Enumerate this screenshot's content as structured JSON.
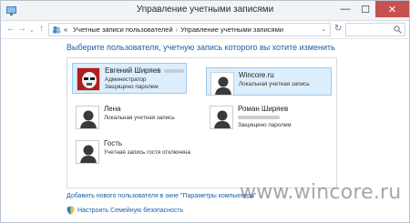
{
  "window": {
    "title": "Управление учетными записями",
    "minimize_glyph": "—",
    "maximize_glyph": "☐",
    "close_glyph": "✕"
  },
  "nav": {
    "back_glyph": "←",
    "forward_glyph": "→",
    "recent_glyph": "⌄",
    "up_glyph": "↑",
    "refresh_glyph": "↻",
    "breadcrumb_prefix": "«",
    "breadcrumb": [
      "Учетные записи пользователей",
      "Управление учетными записями"
    ],
    "separator": "›",
    "dropdown_glyph": "⌄",
    "search_placeholder": ""
  },
  "main": {
    "heading": "Выберите пользователя, учетную запись которого вы хотите изменить",
    "users": [
      {
        "name": "Евгений Ширяев",
        "line1": "Администратор",
        "line2": "Защищено паролем",
        "avatar": "stormtrooper-avatar",
        "selected": true
      },
      {
        "name": "Wincore.ru",
        "line1": "Локальная учетная запись",
        "line2": "",
        "avatar": "default-user-avatar",
        "selected": true
      },
      {
        "name": "Лена",
        "line1": "Локальная учетная запись",
        "line2": "",
        "avatar": "default-user-avatar",
        "selected": false
      },
      {
        "name": "Роман Ширяев",
        "line1": "",
        "line2": "Защищено паролем",
        "avatar": "default-user-avatar",
        "selected": false
      },
      {
        "name": "Гость",
        "line1": "Учетная запись гостя отключена",
        "line2": "",
        "avatar": "default-user-avatar",
        "selected": false
      }
    ],
    "add_user_link": "Добавить нового пользователя в окне \"Параметры компьютера\"",
    "family_safety_link": "Настроить Семейную безопасность"
  },
  "watermark": "www.wincore.ru",
  "colors": {
    "link": "#1b5ea8",
    "selected_bg": "#ddeefc",
    "selected_border": "#9cc8ef",
    "close_button": "#c75050"
  }
}
